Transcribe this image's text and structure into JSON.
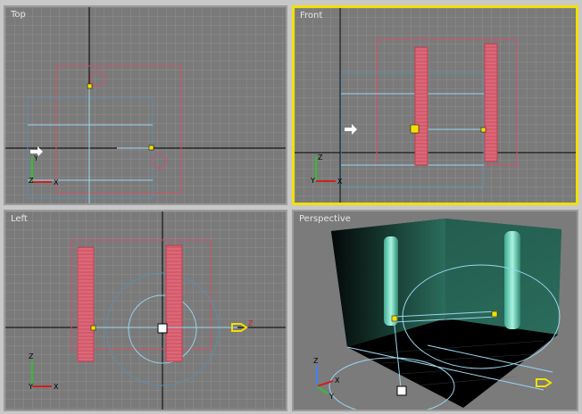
{
  "viewports": {
    "top": {
      "label": "Top"
    },
    "front": {
      "label": "Front"
    },
    "left": {
      "label": "Left"
    },
    "perspective": {
      "label": "Perspective"
    }
  },
  "axes": {
    "x": "X",
    "y": "Y",
    "z": "Z"
  },
  "colors": {
    "viewport_bg": "#7a7a7a",
    "grid": "#8e8e8e",
    "axis_line": "#000000",
    "active_border": "#f2e000",
    "selection_box": "#d4506a",
    "light_blue": "#9ad6f0",
    "column_fill": "#d45a6a",
    "cyan_column": "#6fd9c4"
  }
}
